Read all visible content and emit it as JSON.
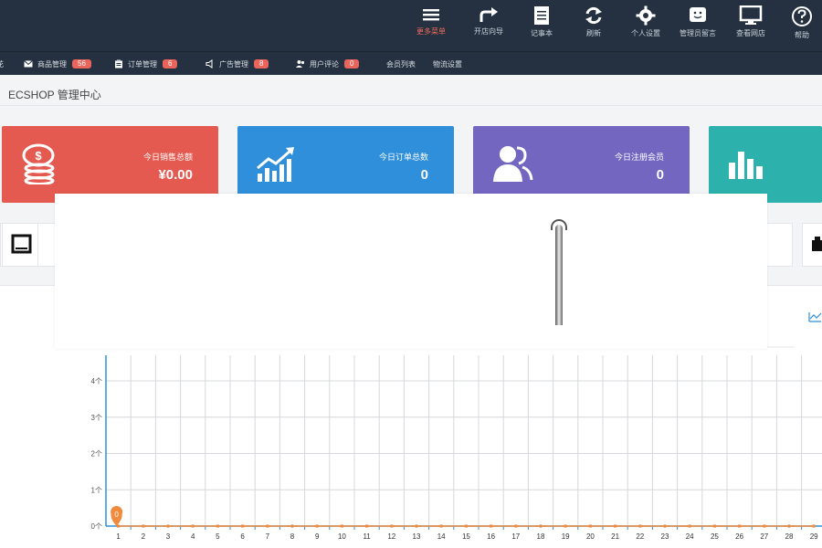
{
  "toolbar": {
    "items": [
      {
        "label": "更多菜单",
        "icon": "menu-icon"
      },
      {
        "label": "开店向导",
        "icon": "redo-arrow-icon"
      },
      {
        "label": "记事本",
        "icon": "notepad-icon"
      },
      {
        "label": "刷新",
        "icon": "refresh-icon"
      },
      {
        "label": "个人设置",
        "icon": "gear-icon"
      },
      {
        "label": "管理员留言",
        "icon": "smiley-message-icon"
      },
      {
        "label": "查看网店",
        "icon": "monitor-icon"
      },
      {
        "label": "帮助",
        "icon": "help-icon"
      }
    ]
  },
  "nav": {
    "items": [
      {
        "label": "商品管理",
        "badge": "56",
        "icon": "mail-icon"
      },
      {
        "label": "订单管理",
        "badge": "6",
        "icon": "clipboard-icon"
      },
      {
        "label": "广告管理",
        "badge": "8",
        "icon": "speaker-icon"
      },
      {
        "label": "用户评论",
        "badge": "0",
        "icon": "users-icon"
      },
      {
        "label": "会员列表",
        "badge": "",
        "icon": ""
      },
      {
        "label": "物流设置",
        "badge": "",
        "icon": ""
      }
    ]
  },
  "page": {
    "title": "ECSHOP 管理中心"
  },
  "cards": [
    {
      "label": "今日销售总额",
      "value": "¥0.00",
      "color": "#e45a50",
      "icon": "coins-icon"
    },
    {
      "label": "今日订单总数",
      "value": "0",
      "color": "#2f8fda",
      "icon": "trend-up-icon"
    },
    {
      "label": "今日注册会员",
      "value": "0",
      "color": "#7366c0",
      "icon": "members-icon"
    },
    {
      "label": "",
      "value": "",
      "color": "#2db1ac",
      "icon": "bar-chart-icon"
    }
  ],
  "colors": {
    "toolbar_bg": "#253140",
    "accent": "#ef6b5c",
    "axis": "#2f8fda",
    "line": "#f08a3c"
  },
  "chart_data": {
    "type": "line",
    "x": [
      "1",
      "2",
      "3",
      "4",
      "5",
      "6",
      "7",
      "8",
      "9",
      "10",
      "11",
      "12",
      "13",
      "14",
      "15",
      "16",
      "17",
      "18",
      "19",
      "20",
      "21",
      "22",
      "23",
      "24",
      "25",
      "26",
      "27",
      "28",
      "29"
    ],
    "series": [
      {
        "values": [
          0,
          0,
          0,
          0,
          0,
          0,
          0,
          0,
          0,
          0,
          0,
          0,
          0,
          0,
          0,
          0,
          0,
          0,
          0,
          0,
          0,
          0,
          0,
          0,
          0,
          0,
          0,
          0,
          0
        ]
      }
    ],
    "ytick_labels": [
      "0个",
      "1个",
      "2个",
      "3个",
      "4个"
    ],
    "ylim": [
      0,
      4
    ],
    "data_labels": [
      "0"
    ],
    "grid": true
  }
}
